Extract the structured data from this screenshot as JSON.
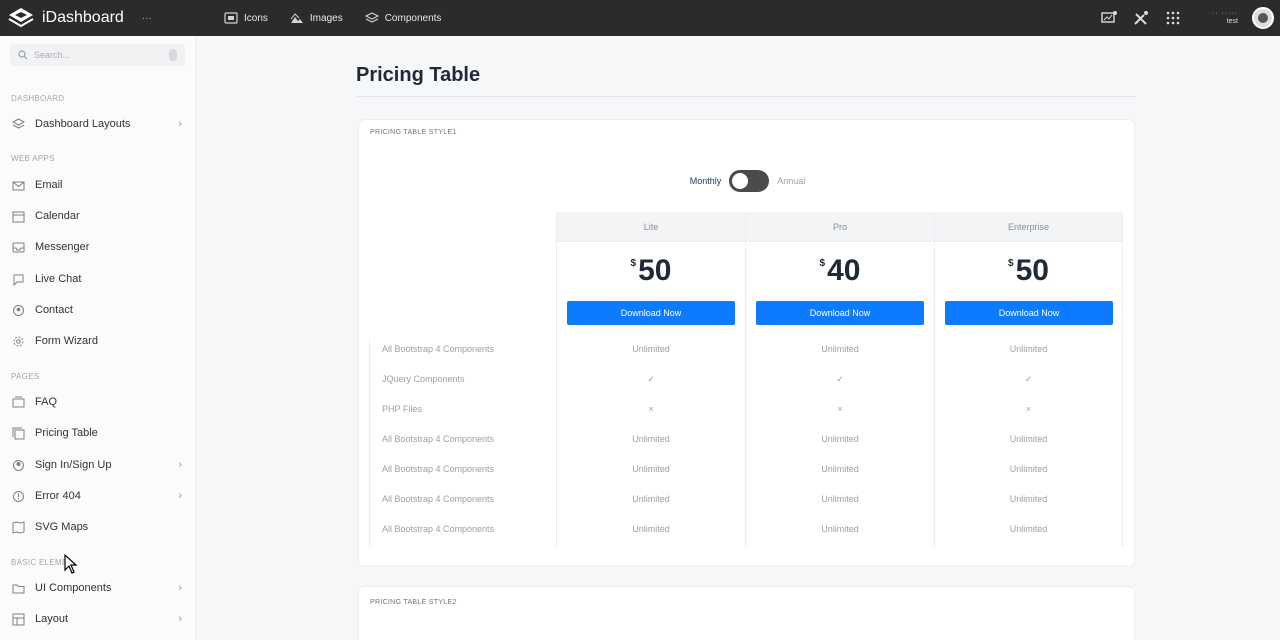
{
  "app": {
    "brand": "iDashboard",
    "caret": "···"
  },
  "topnav": [
    {
      "label": "Icons",
      "icon": "icons-icon"
    },
    {
      "label": "Images",
      "icon": "images-icon"
    },
    {
      "label": "Components",
      "icon": "components-icon"
    }
  ],
  "user": {
    "dots": "·· ·····",
    "name": "test"
  },
  "sidebar": {
    "search_placeholder": "Search...",
    "sections": [
      {
        "title": "DASHBOARD"
      },
      {
        "title": "WEB APPS"
      },
      {
        "title": "PAGES"
      },
      {
        "title": "BASIC ELEME..."
      }
    ],
    "items": [
      {
        "label": "Dashboard Layouts",
        "icon": "layers-icon",
        "chevron": true
      },
      {
        "label": "Email",
        "icon": "mail-icon",
        "chevron": false
      },
      {
        "label": "Calendar",
        "icon": "calendar-icon",
        "chevron": false
      },
      {
        "label": "Messenger",
        "icon": "inbox-icon",
        "chevron": false
      },
      {
        "label": "Live Chat",
        "icon": "chat-icon",
        "chevron": false
      },
      {
        "label": "Contact",
        "icon": "contact-icon",
        "chevron": false
      },
      {
        "label": "Form Wizard",
        "icon": "gear-icon",
        "chevron": false
      },
      {
        "label": "FAQ",
        "icon": "faq-icon",
        "chevron": false
      },
      {
        "label": "Pricing Table",
        "icon": "copy-icon",
        "chevron": false
      },
      {
        "label": "Sign In/Sign Up",
        "icon": "user-icon",
        "chevron": true
      },
      {
        "label": "Error 404",
        "icon": "alert-icon",
        "chevron": true
      },
      {
        "label": "SVG Maps",
        "icon": "map-icon",
        "chevron": false
      },
      {
        "label": "UI Components",
        "icon": "folder-icon",
        "chevron": true
      },
      {
        "label": "Layout",
        "icon": "layout-icon",
        "chevron": true
      }
    ]
  },
  "main": {
    "title": "Pricing Table",
    "card1_label": "PRICING TABLE STYLE1",
    "card2_label": "PRICING TABLE STYLE2",
    "toggle": {
      "left": "Monthly",
      "right": "Annual"
    },
    "plans": [
      {
        "name": "Lite",
        "currency": "$",
        "price": "50",
        "button": "Download Now",
        "cells": [
          "Unlimited",
          "✓",
          "×",
          "Unlimited",
          "Unlimited",
          "Unlimited",
          "Unlimited"
        ]
      },
      {
        "name": "Pro",
        "currency": "$",
        "price": "40",
        "button": "Download Now",
        "cells": [
          "Unlimited",
          "✓",
          "×",
          "Unlimited",
          "Unlimited",
          "Unlimited",
          "Unlimited"
        ]
      },
      {
        "name": "Enterprise",
        "currency": "$",
        "price": "50",
        "button": "Download Now",
        "cells": [
          "Unlimited",
          "✓",
          "×",
          "Unlimited",
          "Unlimited",
          "Unlimited",
          "Unlimited"
        ]
      }
    ],
    "features": [
      "All Bootstrap 4 Components",
      "JQuery Components",
      "PHP Files",
      "All Bootstrap 4 Components",
      "All Bootstrap 4 Components",
      "All Bootstrap 4 Components",
      "All Bootstrap 4 Components"
    ]
  },
  "colors": {
    "topbar": "#2b2b2b",
    "accent": "#0d7bff",
    "title": "#1f2937"
  }
}
